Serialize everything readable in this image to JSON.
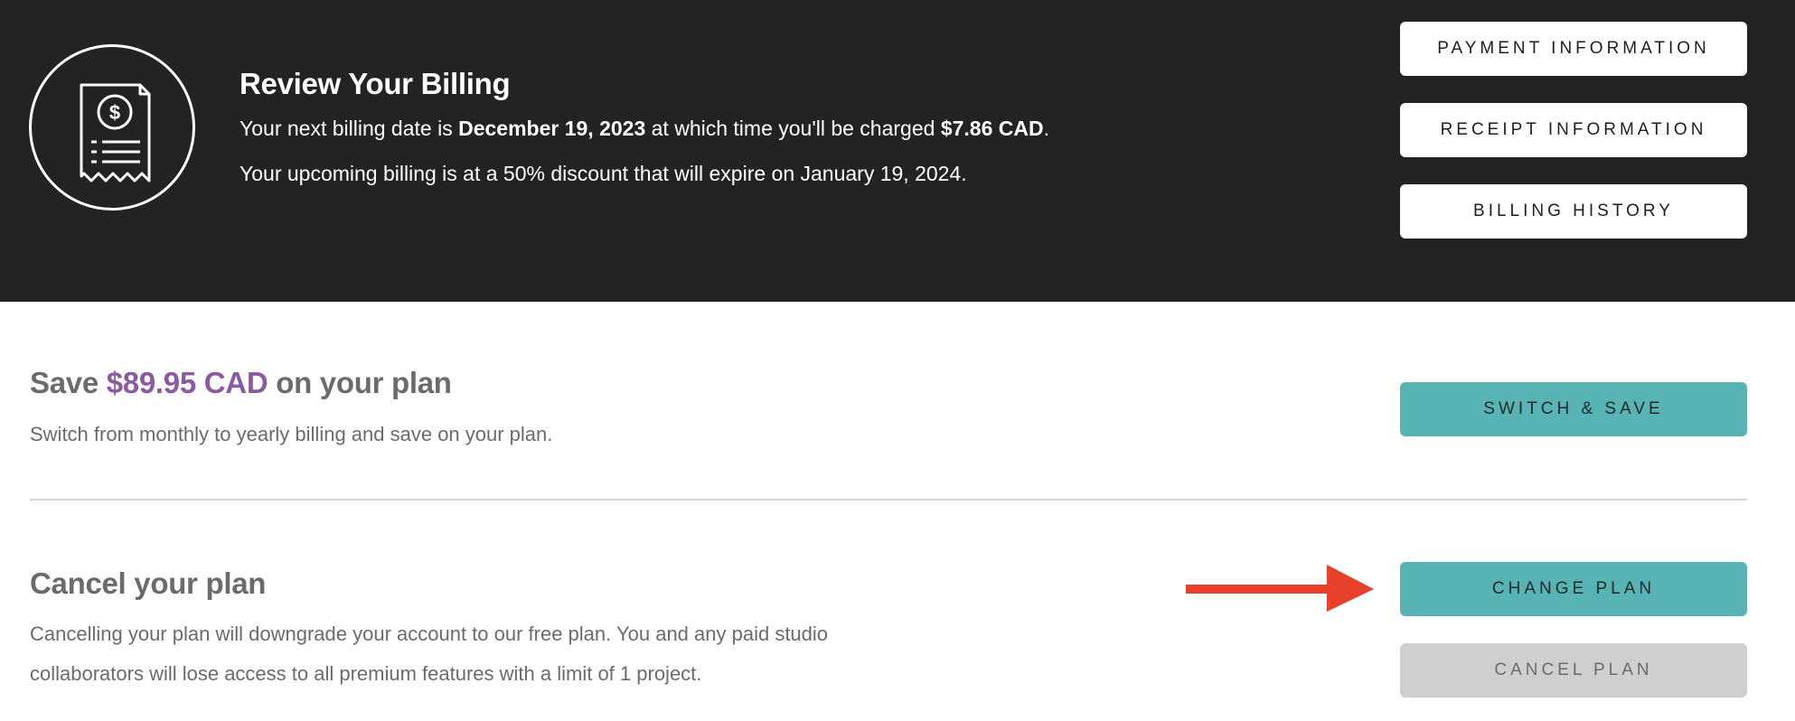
{
  "header": {
    "title": "Review Your Billing",
    "billing_line": {
      "prefix": "Your next billing date is ",
      "date": "December 19, 2023",
      "middle": " at which time you'll be charged ",
      "amount": "$7.86 CAD",
      "suffix": "."
    },
    "discount_line": "Your upcoming billing is at a 50% discount that will expire on January 19, 2024.",
    "buttons": {
      "payment": "PAYMENT INFORMATION",
      "receipt": "RECEIPT INFORMATION",
      "history": "BILLING HISTORY"
    },
    "icon": "receipt-dollar-icon"
  },
  "save_section": {
    "title_prefix": "Save ",
    "amount": "$89.95 CAD",
    "title_suffix": " on your plan",
    "description": "Switch from monthly to yearly billing and save on your plan.",
    "button": "SWITCH & SAVE"
  },
  "cancel_section": {
    "title": "Cancel your plan",
    "description_line1": "Cancelling your plan will downgrade your account to our free plan. You and any paid studio",
    "description_line2": "collaborators will lose access to all premium features with a limit of 1 project.",
    "change_button": "CHANGE PLAN",
    "cancel_button": "CANCEL PLAN",
    "pointer": "arrow-right-icon"
  },
  "colors": {
    "header_bg": "#232323",
    "teal": "#58b4b4",
    "accent_purple": "#8a5aa3",
    "arrow_red": "#e8402a",
    "disabled_grey": "#cfcfcf"
  }
}
